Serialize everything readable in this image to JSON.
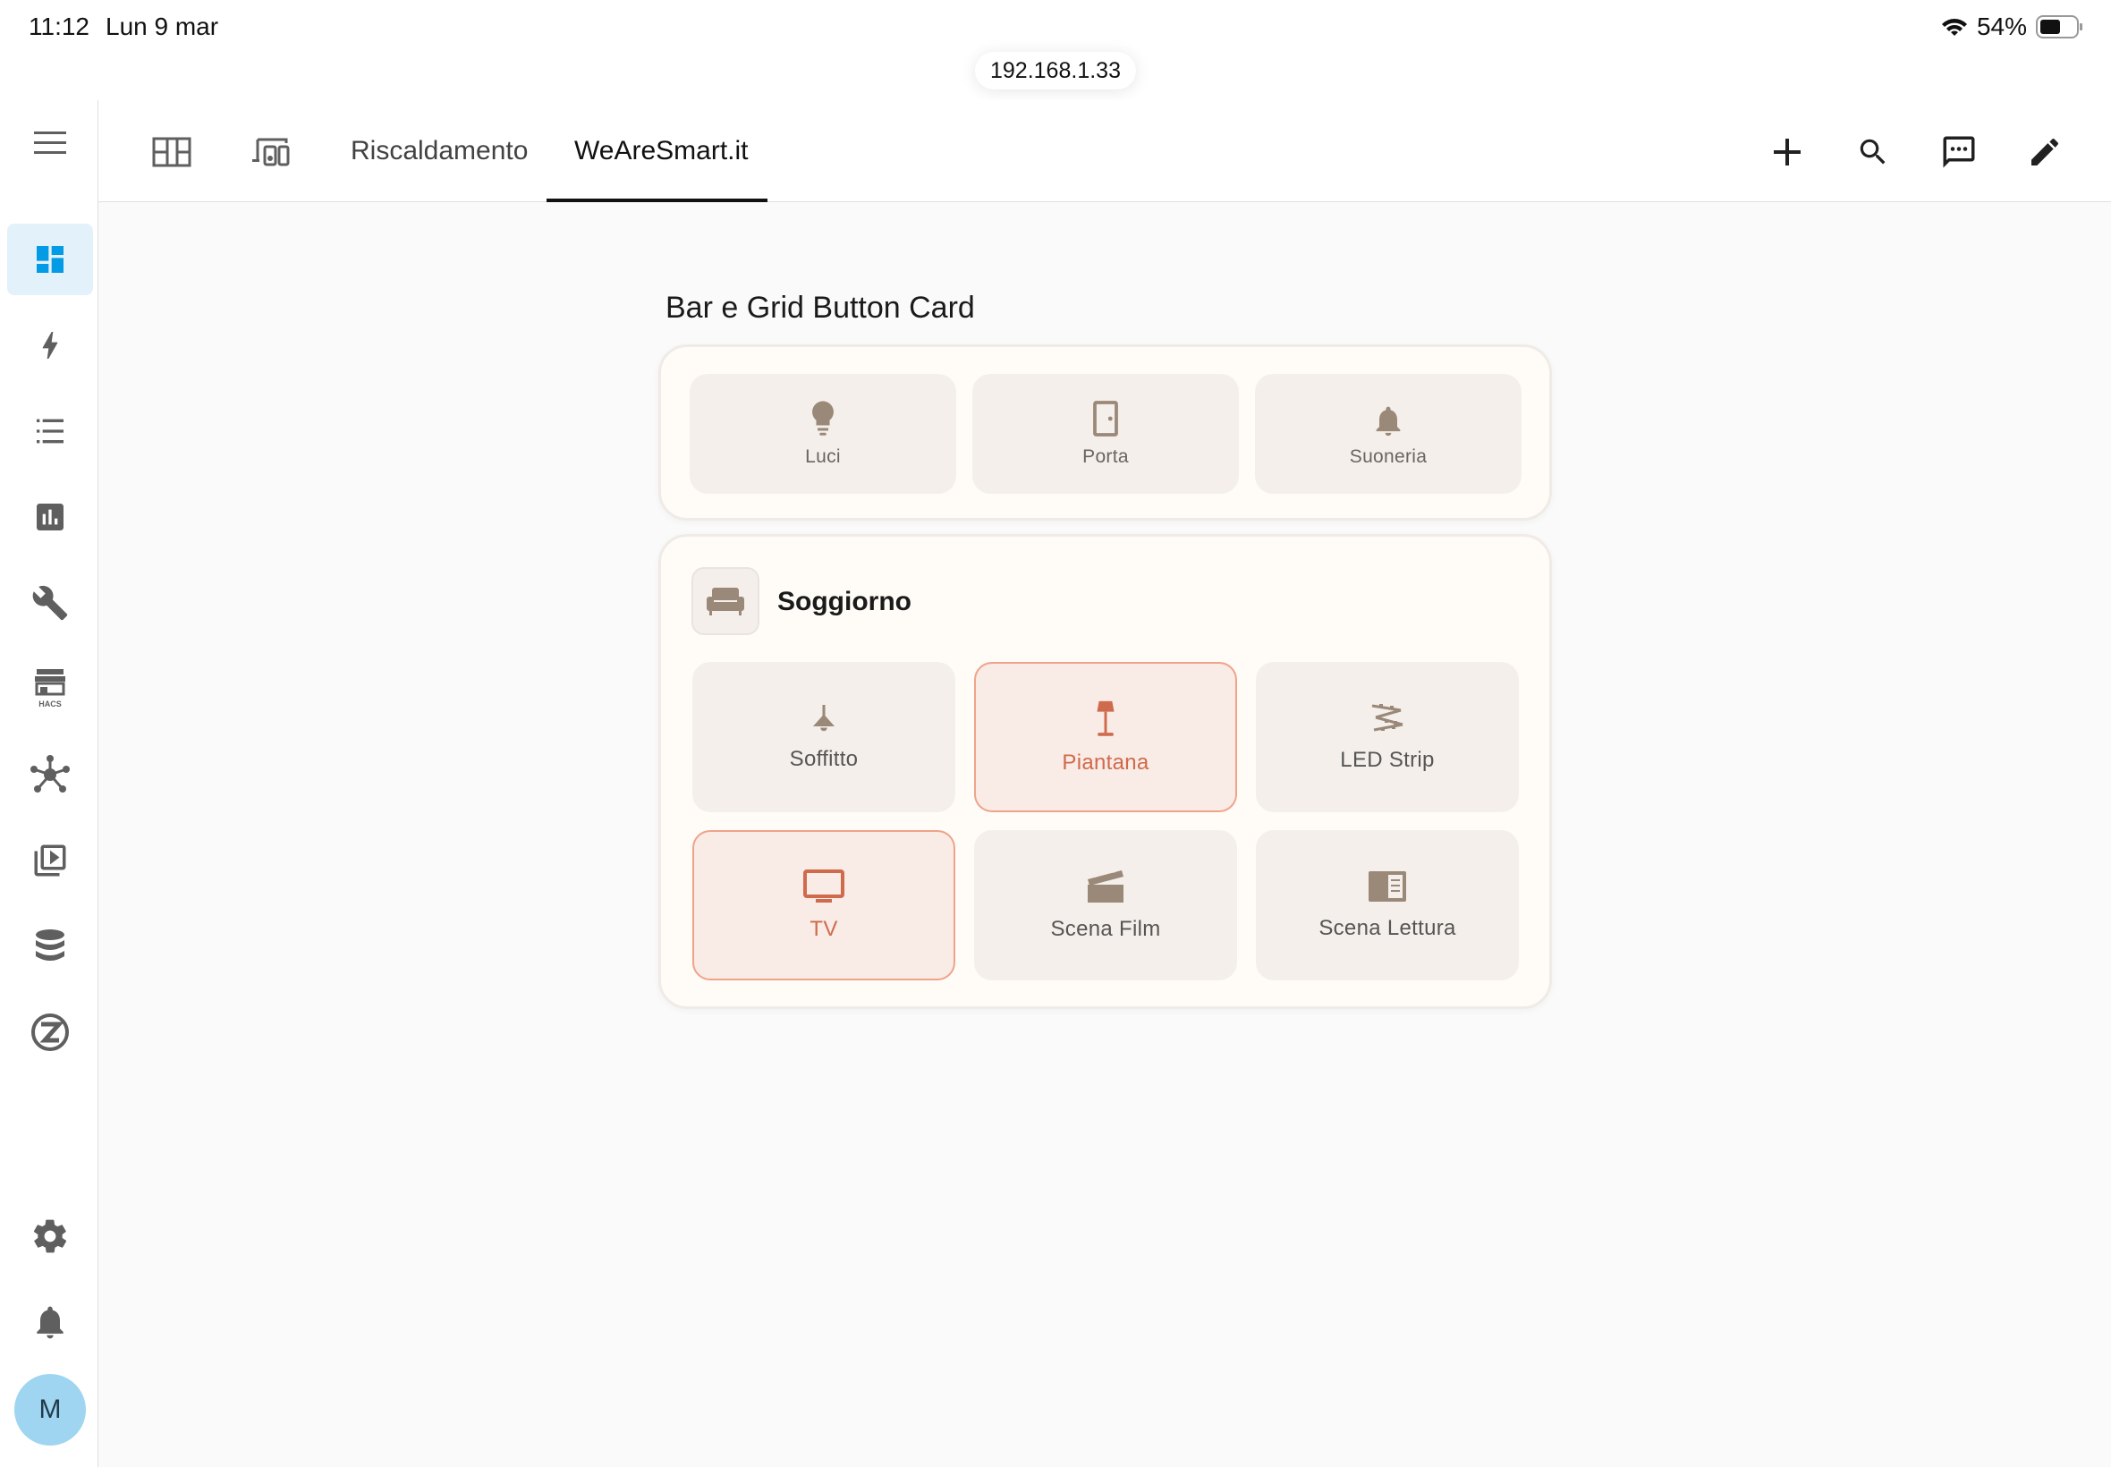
{
  "status_bar": {
    "time": "11:12",
    "date": "Lun 9 mar",
    "battery": "54%",
    "url": "192.168.1.33"
  },
  "toolbar": {
    "tabs": [
      {
        "icon": "dashboard-grid-icon"
      },
      {
        "icon": "devices-icon"
      },
      {
        "label": "Riscaldamento"
      },
      {
        "label": "WeAreSmart.it",
        "active": true
      }
    ],
    "actions": [
      "add-icon",
      "search-icon",
      "assist-icon",
      "edit-icon"
    ]
  },
  "sidebar": {
    "items": [
      "dashboard-icon",
      "energy-icon",
      "logbook-icon",
      "history-icon",
      "developer-tools-icon",
      "hacs-icon",
      "zigbee-icon",
      "media-icon",
      "database-icon",
      "z-wave-icon"
    ],
    "bottom": [
      "settings-icon",
      "notifications-icon"
    ],
    "avatar_initial": "M"
  },
  "section": {
    "title": "Bar e Grid Button Card"
  },
  "bar_card": {
    "buttons": [
      {
        "label": "Luci",
        "icon": "lightbulb-icon"
      },
      {
        "label": "Porta",
        "icon": "door-icon"
      },
      {
        "label": "Suoneria",
        "icon": "bell-icon"
      }
    ]
  },
  "room_card": {
    "title": "Soggiorno",
    "icon": "sofa-icon",
    "buttons": [
      {
        "label": "Soffitto",
        "icon": "ceiling-light-icon",
        "state": "off"
      },
      {
        "label": "Piantana",
        "icon": "floor-lamp-icon",
        "state": "on"
      },
      {
        "label": "LED Strip",
        "icon": "led-strip-icon",
        "state": "off"
      },
      {
        "label": "TV",
        "icon": "tv-icon",
        "state": "on"
      },
      {
        "label": "Scena Film",
        "icon": "movie-icon",
        "state": "off"
      },
      {
        "label": "Scena Lettura",
        "icon": "book-icon",
        "state": "off"
      }
    ]
  },
  "colors": {
    "accent": "#039be5",
    "active": "#d06a4c",
    "neutral_icon": "#9a8878",
    "sidebar_icon": "#5f5f5f"
  }
}
